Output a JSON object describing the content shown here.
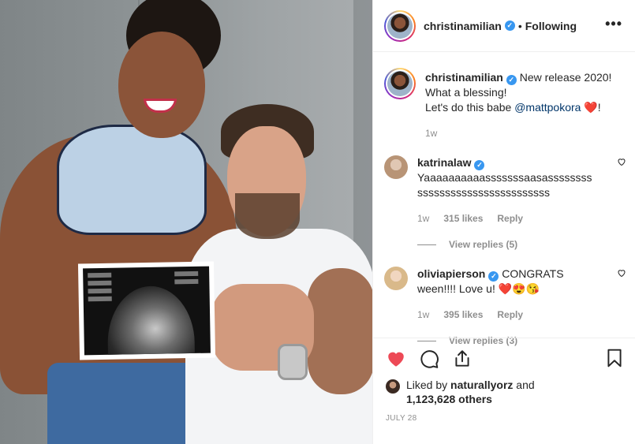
{
  "post": {
    "author": "christinamilian",
    "follow_separator": "•",
    "follow_status": "Following",
    "more_label": "•••",
    "verified_mark": "✓"
  },
  "caption": {
    "username": "christinamilian",
    "line1": "New release 2020!",
    "line2": "What a blessing!",
    "line3_prefix": "Let's do this babe ",
    "mention": "@mattpokora",
    "line3_suffix": "!",
    "emoji": "❤️",
    "age": "1w"
  },
  "comments": [
    {
      "username": "katrinalaw",
      "text": "Yaaaaaaaaaasssssssaasassssssssssssssssssssssssssssssss",
      "age": "1w",
      "likes": "315 likes",
      "reply_label": "Reply",
      "view_replies": "View replies (5)",
      "avatar_color": "#d8c4b0"
    },
    {
      "username": "oliviapierson",
      "text": "CONGRATS ween!!!! Love u!",
      "emojis": "❤️😍😘",
      "age": "1w",
      "likes": "395 likes",
      "reply_label": "Reply",
      "view_replies": "View replies (3)",
      "avatar_color": "#e8cba8"
    }
  ],
  "engagement": {
    "liked_by_prefix": "Liked by ",
    "liked_by_user": "naturallyorz",
    "liked_by_conjunction": " and",
    "others_count": "1,123,628 others",
    "date": "JULY 28"
  },
  "icons": {
    "like": "heart-icon",
    "comment": "comment-icon",
    "share": "share-icon",
    "save": "bookmark-icon",
    "comment_like": "heart-outline-icon"
  },
  "colors": {
    "like_red": "#ed4956",
    "verified_blue": "#3897f0",
    "mention_blue": "#003569",
    "muted": "#8e8e8e"
  }
}
